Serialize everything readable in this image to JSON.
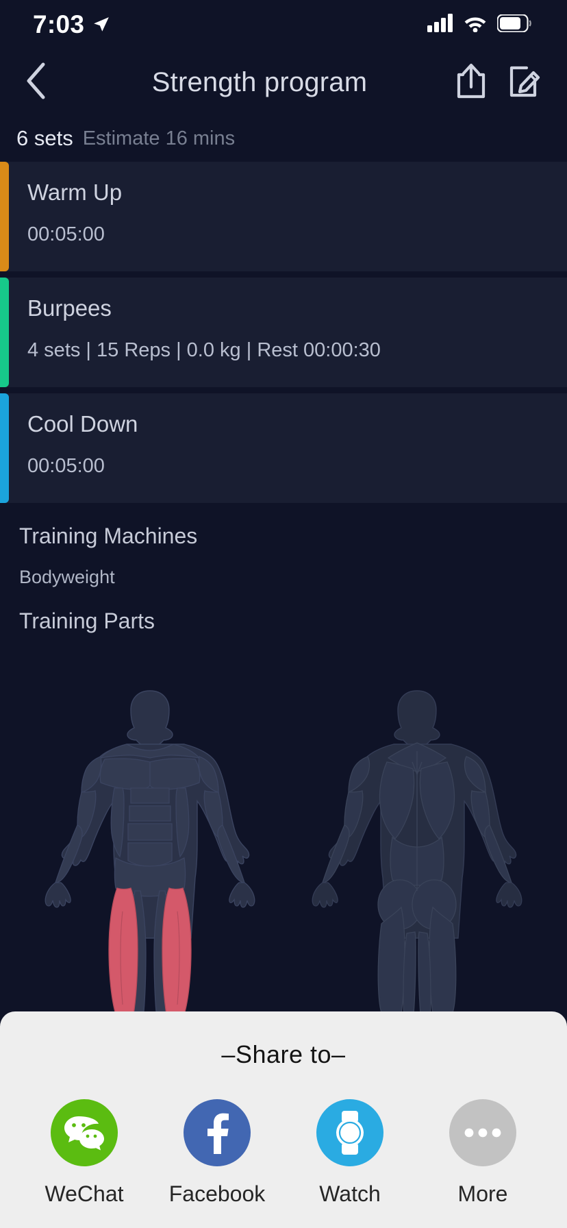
{
  "status_bar": {
    "time": "7:03",
    "location_icon": "location-arrow-icon",
    "signal_icon": "cellular-signal-icon",
    "wifi_icon": "wifi-icon",
    "battery_icon": "battery-icon"
  },
  "header": {
    "back_icon": "chevron-left-icon",
    "title": "Strength program",
    "share_icon": "share-upload-icon",
    "edit_icon": "edit-pencil-icon"
  },
  "summary": {
    "sets": "6 sets",
    "estimate": "Estimate 16 mins"
  },
  "sets": [
    {
      "name": "Warm Up",
      "detail": "00:05:00",
      "accent": "#d98a18"
    },
    {
      "name": "Burpees",
      "detail": "4 sets | 15 Reps | 0.0 kg | Rest 00:00:30",
      "accent": "#17c98a"
    },
    {
      "name": "Cool Down",
      "detail": "00:05:00",
      "accent": "#1ba4dc"
    }
  ],
  "sections": {
    "machines_label": "Training Machines",
    "machines_value": "Bodyweight",
    "parts_label": "Training Parts"
  },
  "body_diagram": {
    "front_view": "body-front-muscle-map",
    "back_view": "body-back-muscle-map",
    "highlight_color": "#d4596a",
    "muscle_color": "#2c3348",
    "outline_color": "#3b4460",
    "highlighted_muscles": [
      "Quadriceps"
    ]
  },
  "share_sheet": {
    "title": "–Share to–",
    "options": [
      {
        "label": "WeChat",
        "icon": "wechat-icon",
        "color": "#5bbc11"
      },
      {
        "label": "Facebook",
        "icon": "facebook-icon",
        "color": "#4267b2"
      },
      {
        "label": "Watch",
        "icon": "watch-icon",
        "color": "#2aabe2"
      },
      {
        "label": "More",
        "icon": "more-dots-icon",
        "color": "#c2c2c2"
      }
    ]
  }
}
